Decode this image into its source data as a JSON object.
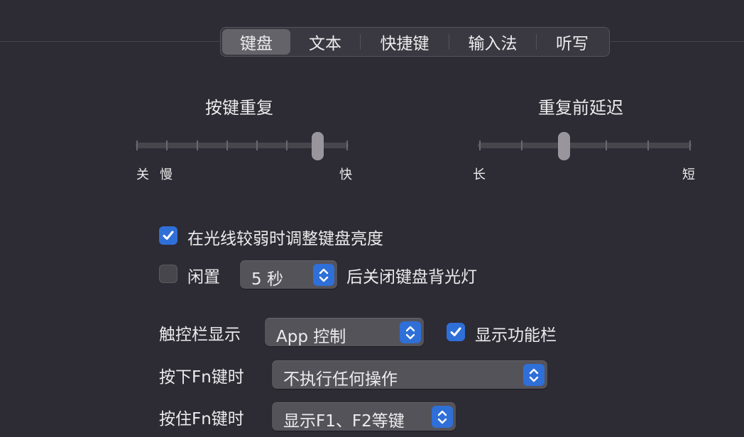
{
  "tabs": [
    "键盘",
    "文本",
    "快捷键",
    "输入法",
    "听写"
  ],
  "key_repeat": {
    "title": "按键重复",
    "labels": {
      "off": "关",
      "slow": "慢",
      "fast": "快"
    },
    "tick_count": 8,
    "selected_tick": 6
  },
  "delay": {
    "title": "重复前延迟",
    "labels": {
      "long": "长",
      "short": "短"
    },
    "tick_count": 6,
    "selected_tick": 2
  },
  "brightness": {
    "label": "在光线较弱时调整键盘亮度",
    "checked": true
  },
  "idle": {
    "prefix": "闲置",
    "value": "5 秒",
    "suffix": "后关闭键盘背光灯",
    "checked": false
  },
  "touchbar": {
    "label": "触控栏显示",
    "value": "App 控制",
    "show_fn_label": "显示功能栏",
    "show_fn_checked": true
  },
  "press_fn": {
    "label": "按下Fn键时",
    "value": "不执行任何操作"
  },
  "hold_fn": {
    "label": "按住Fn键时",
    "value": "显示F1、F2等键"
  },
  "colors": {
    "accent": "#2f6fd8",
    "background": "#2d2b33"
  }
}
